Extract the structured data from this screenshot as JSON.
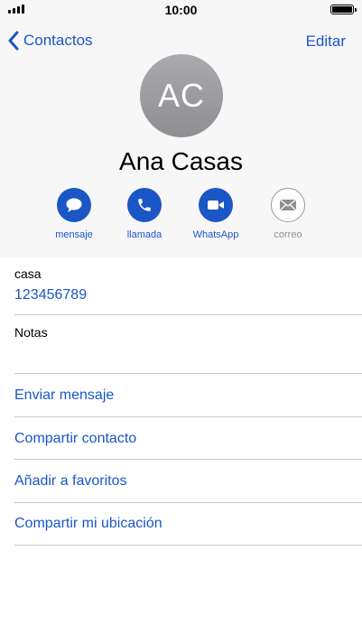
{
  "status_bar": {
    "time": "10:00"
  },
  "nav": {
    "back_label": "Contactos",
    "edit_label": "Editar"
  },
  "contact": {
    "initials": "AC",
    "name": "Ana Casas"
  },
  "actions": [
    {
      "label": "mensaje",
      "icon": "message-icon",
      "enabled": true
    },
    {
      "label": "llamada",
      "icon": "phone-icon",
      "enabled": true
    },
    {
      "label": "WhatsApp",
      "icon": "video-icon",
      "enabled": true
    },
    {
      "label": "correo",
      "icon": "mail-icon",
      "enabled": false
    }
  ],
  "phone": {
    "label": "casa",
    "number": "123456789"
  },
  "notes": {
    "label": "Notas"
  },
  "links": {
    "send_message": "Enviar mensaje",
    "share_contact": "Compartir contacto",
    "add_favorites": "Añadir a favoritos",
    "share_location": "Compartir mi ubicación"
  },
  "colors": {
    "accent": "#1a56c5",
    "header_bg": "#f7f7f8",
    "avatar": "#8e8e93",
    "separator": "#c8c7cc"
  }
}
